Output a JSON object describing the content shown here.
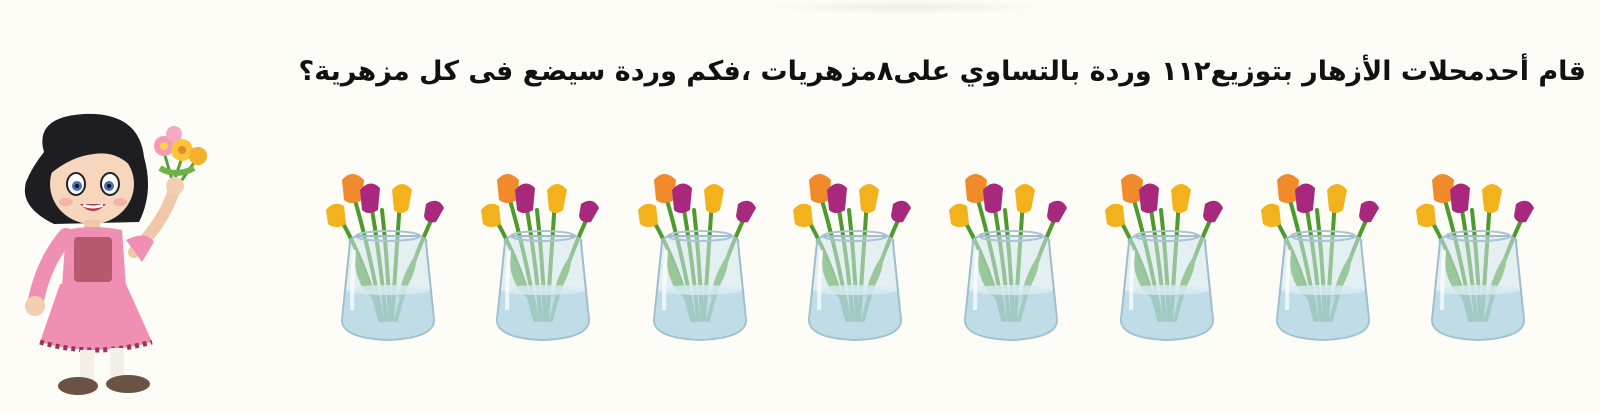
{
  "question": {
    "text": "قام أحدمحلات الأزهار بتوزيع١١٢ وردة بالتساوي على٨مزهريات ،فكم وردة سيضع فى كل مزهرية؟"
  },
  "illustration": {
    "vase_count": 8,
    "vase_icon": "tulip-vase-icon",
    "character_icon": "girl-holding-flowers-icon",
    "colors": {
      "background": "#fdfcf7",
      "tulip_orange": "#f08a2a",
      "tulip_purple": "#a8287e",
      "tulip_yellow": "#f2b21c",
      "stem_green": "#4f9a2e",
      "glass": "#cfe4ec",
      "water": "#a9cfdf",
      "dress_pink": "#ef8fb4"
    }
  }
}
